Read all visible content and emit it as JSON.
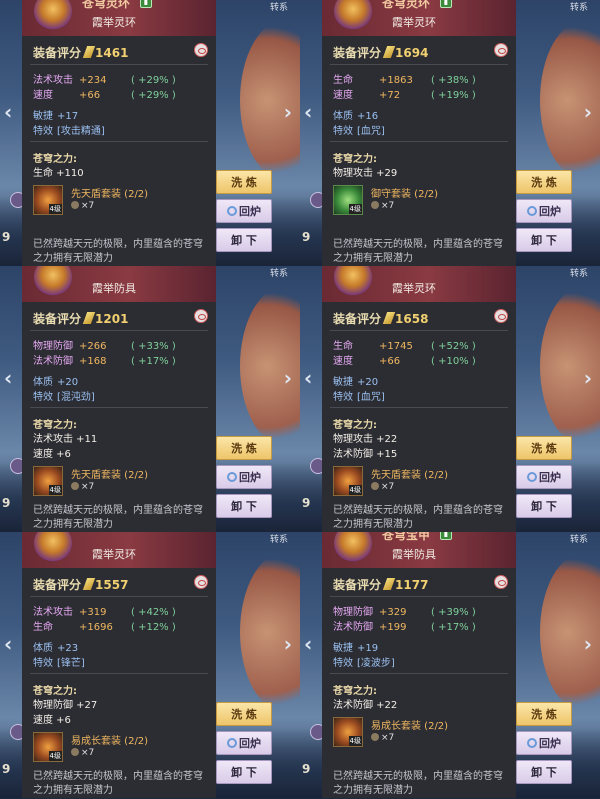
{
  "labels": {
    "score": "装备评分",
    "power_title": "苍穹之力:",
    "wash": "洗 炼",
    "recycle": "回炉",
    "unequip": "卸 下",
    "desc": "已然跨越天元的极限，内里蕴含的苍穹",
    "desc2": "之力拥有无限潜力"
  },
  "screen_texts": {
    "corner": "转系",
    "left_digit": "9"
  },
  "cards": [
    {
      "title": "苍穹灵环",
      "subtitle": "霞举灵环",
      "score": "1461",
      "stats": [
        {
          "label": "法术攻击",
          "value": "+234",
          "pct": "( +29% )",
          "tone": "purple"
        },
        {
          "label": "速度",
          "value": "+66",
          "pct": "( +29% )",
          "tone": "purple"
        }
      ],
      "extra": [
        {
          "label": "敏捷",
          "value": "+17"
        },
        {
          "label": "特效",
          "value": "[攻击精通]"
        }
      ],
      "power": [
        "生命 +110"
      ],
      "set_name": "先天盾套装 (2/2)",
      "set_level": "4级",
      "set_count": "×7",
      "set_tone": "orange"
    },
    {
      "title": "苍穹灵环",
      "subtitle": "霞举灵环",
      "score": "1694",
      "stats": [
        {
          "label": "生命",
          "value": "+1863",
          "pct": "( +38% )",
          "tone": "orange"
        },
        {
          "label": "速度",
          "value": "+72",
          "pct": "( +19% )",
          "tone": "orange"
        }
      ],
      "extra": [
        {
          "label": "体质",
          "value": "+16"
        },
        {
          "label": "特效",
          "value": "[血咒]"
        }
      ],
      "power": [
        "物理攻击 +29"
      ],
      "set_name": "御守套装 (2/2)",
      "set_level": "4级",
      "set_count": "×7",
      "set_tone": "green"
    },
    {
      "title": "",
      "subtitle": "霞举防具",
      "score": "1201",
      "stats": [
        {
          "label": "物理防御",
          "value": "+266",
          "pct": "( +33% )",
          "tone": "purple"
        },
        {
          "label": "法术防御",
          "value": "+168",
          "pct": "( +17% )",
          "tone": "purple"
        }
      ],
      "extra": [
        {
          "label": "体质",
          "value": "+20"
        },
        {
          "label": "特效",
          "value": "[混沌劲]"
        }
      ],
      "power": [
        "法术攻击 +11",
        "速度 +6"
      ],
      "set_name": "先天盾套装 (2/2)",
      "set_level": "4级",
      "set_count": "×7",
      "set_tone": "orange"
    },
    {
      "title": "",
      "subtitle": "霞举灵环",
      "score": "1658",
      "stats": [
        {
          "label": "生命",
          "value": "+1745",
          "pct": "( +52% )",
          "tone": "orange"
        },
        {
          "label": "速度",
          "value": "+66",
          "pct": "( +10% )",
          "tone": "orange"
        }
      ],
      "extra": [
        {
          "label": "敏捷",
          "value": "+20"
        },
        {
          "label": "特效",
          "value": "[血咒]"
        }
      ],
      "power": [
        "物理攻击 +22",
        "法术防御 +15"
      ],
      "set_name": "先天盾套装 (2/2)",
      "set_level": "4级",
      "set_count": "×7",
      "set_tone": "orange"
    },
    {
      "title": "",
      "subtitle": "霞举灵环",
      "score": "1557",
      "stats": [
        {
          "label": "法术攻击",
          "value": "+319",
          "pct": "( +42% )",
          "tone": "purple"
        },
        {
          "label": "生命",
          "value": "+1696",
          "pct": "( +12% )",
          "tone": "purple"
        }
      ],
      "extra": [
        {
          "label": "体质",
          "value": "+23"
        },
        {
          "label": "特效",
          "value": "[锋芒]"
        }
      ],
      "power": [
        "物理防御 +27",
        "速度 +6"
      ],
      "set_name": "易成长套装 (2/2)",
      "set_level": "4级",
      "set_count": "×7",
      "set_tone": "orange"
    },
    {
      "title": "苍穹宝甲",
      "subtitle": "霞举防具",
      "score": "1177",
      "stats": [
        {
          "label": "物理防御",
          "value": "+329",
          "pct": "( +39% )",
          "tone": "purple"
        },
        {
          "label": "法术防御",
          "value": "+199",
          "pct": "( +17% )",
          "tone": "purple"
        }
      ],
      "extra": [
        {
          "label": "敏捷",
          "value": "+19"
        },
        {
          "label": "特效",
          "value": "[凌波步]"
        }
      ],
      "power": [
        "法术防御 +22"
      ],
      "set_name": "易成长套装 (2/2)",
      "set_level": "4级",
      "set_count": "×7",
      "set_tone": "orange"
    }
  ]
}
